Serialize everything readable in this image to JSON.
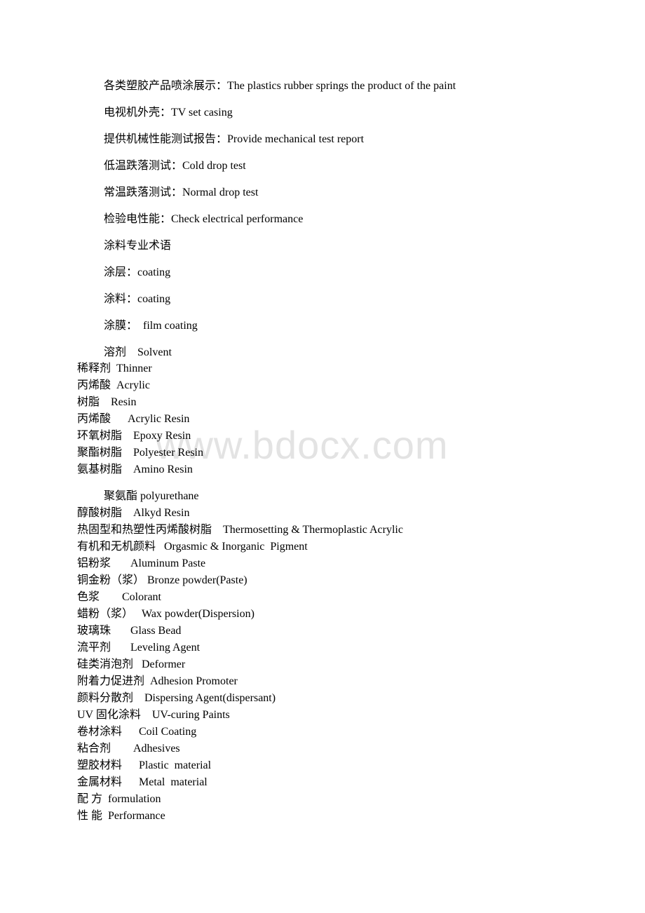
{
  "watermark": "www.bdocx.com",
  "spaced_lines": [
    "各类塑胶产品喷涂展示：The plastics rubber springs the product of the paint",
    "电视机外壳：TV set casing",
    "提供机械性能测试报告：Provide mechanical test report",
    "低温跌落测试：Cold drop test",
    "常温跌落测试：Normal drop test",
    "检验电性能：Check electrical performance",
    "涂料专业术语",
    "涂层：coating",
    "涂料：coating",
    "涂膜：  film coating",
    "溶剂    Solvent"
  ],
  "block1": [
    "稀释剂  Thinner",
    "丙烯酸  Acrylic",
    "树脂    Resin",
    "丙烯酸      Acrylic Resin",
    "环氧树脂    Epoxy Resin",
    "聚酯树脂    Polyester Resin",
    "氨基树脂    Amino Resin"
  ],
  "polyurethane_line": "聚氨酯 polyurethane",
  "block2": [
    "醇酸树脂    Alkyd Resin",
    "热固型和热塑性丙烯酸树脂    Thermosetting & Thermoplastic Acrylic",
    "有机和无机颜料   Orgasmic & Inorganic  Pigment",
    "铝粉浆       Aluminum Paste",
    "铜金粉（浆） Bronze powder(Paste)",
    "色浆        Colorant",
    "蜡粉（浆）   Wax powder(Dispersion)",
    "玻璃珠       Glass Bead",
    "流平剂       Leveling Agent",
    "硅类消泡剂   Deformer",
    "附着力促进剂  Adhesion Promoter",
    "颜料分散剂    Dispersing Agent(dispersant)",
    "UV 固化涂料    UV-curing Paints",
    "卷材涂料      Coil Coating",
    "粘合剂        Adhesives",
    "塑胶材料      Plastic  material",
    "金属材料      Metal  material",
    "配 方  formulation",
    "性 能  Performance"
  ]
}
